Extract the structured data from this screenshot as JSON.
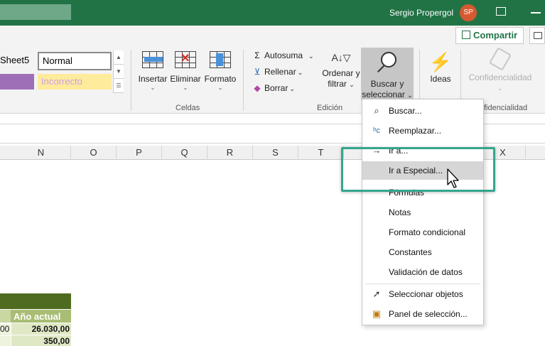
{
  "titlebar": {
    "user_name": "Sergio Propergol",
    "avatar_initials": "SP"
  },
  "ribbon": {
    "share_label": "Compartir",
    "styles": {
      "sheet5": "Sheet5",
      "normal": "Normal",
      "bad": "Incorrecto"
    },
    "cells_group": {
      "label": "Celdas",
      "insert": "Insertar",
      "delete": "Eliminar",
      "format": "Formato"
    },
    "editing_group": {
      "label": "Edición",
      "autosum": "Autosuma",
      "fill": "Rellenar",
      "clear": "Borrar",
      "sort_line1": "Ordenar y",
      "sort_line2": "filtrar",
      "find_line1": "Buscar y",
      "find_line2": "seleccionar"
    },
    "ideas": "Ideas",
    "confidentiality": "Confidencialidad",
    "confidentiality_group_label": "fidencialidad"
  },
  "columns": [
    "N",
    "O",
    "P",
    "Q",
    "R",
    "S",
    "T",
    "X"
  ],
  "table": {
    "header": "Año actual",
    "rows": [
      {
        "left": "00",
        "value": "26.030,00"
      },
      {
        "left": "",
        "value": "350,00"
      }
    ]
  },
  "menu": {
    "items": [
      {
        "label": "Buscar...",
        "icon": "search-icon"
      },
      {
        "label": "Reemplazar...",
        "icon": "replace-icon"
      },
      {
        "label": "Ir a...",
        "icon": "arrow-right-icon"
      },
      {
        "label": "Ir a Especial...",
        "icon": ""
      },
      {
        "label": "Fórmulas",
        "icon": ""
      },
      {
        "label": "Notas",
        "icon": ""
      },
      {
        "label": "Formato condicional",
        "icon": ""
      },
      {
        "label": "Constantes",
        "icon": ""
      },
      {
        "label": "Validación de datos",
        "icon": ""
      },
      {
        "label": "Seleccionar objetos",
        "icon": "pointer-icon"
      },
      {
        "label": "Panel de selección...",
        "icon": "selection-pane-icon"
      }
    ],
    "hovered_item": "Ir a Especial..."
  },
  "colors": {
    "brand": "#217346",
    "highlight": "#35a58d",
    "table_dark": "#4e6b20",
    "table_header": "#a9bd74"
  }
}
